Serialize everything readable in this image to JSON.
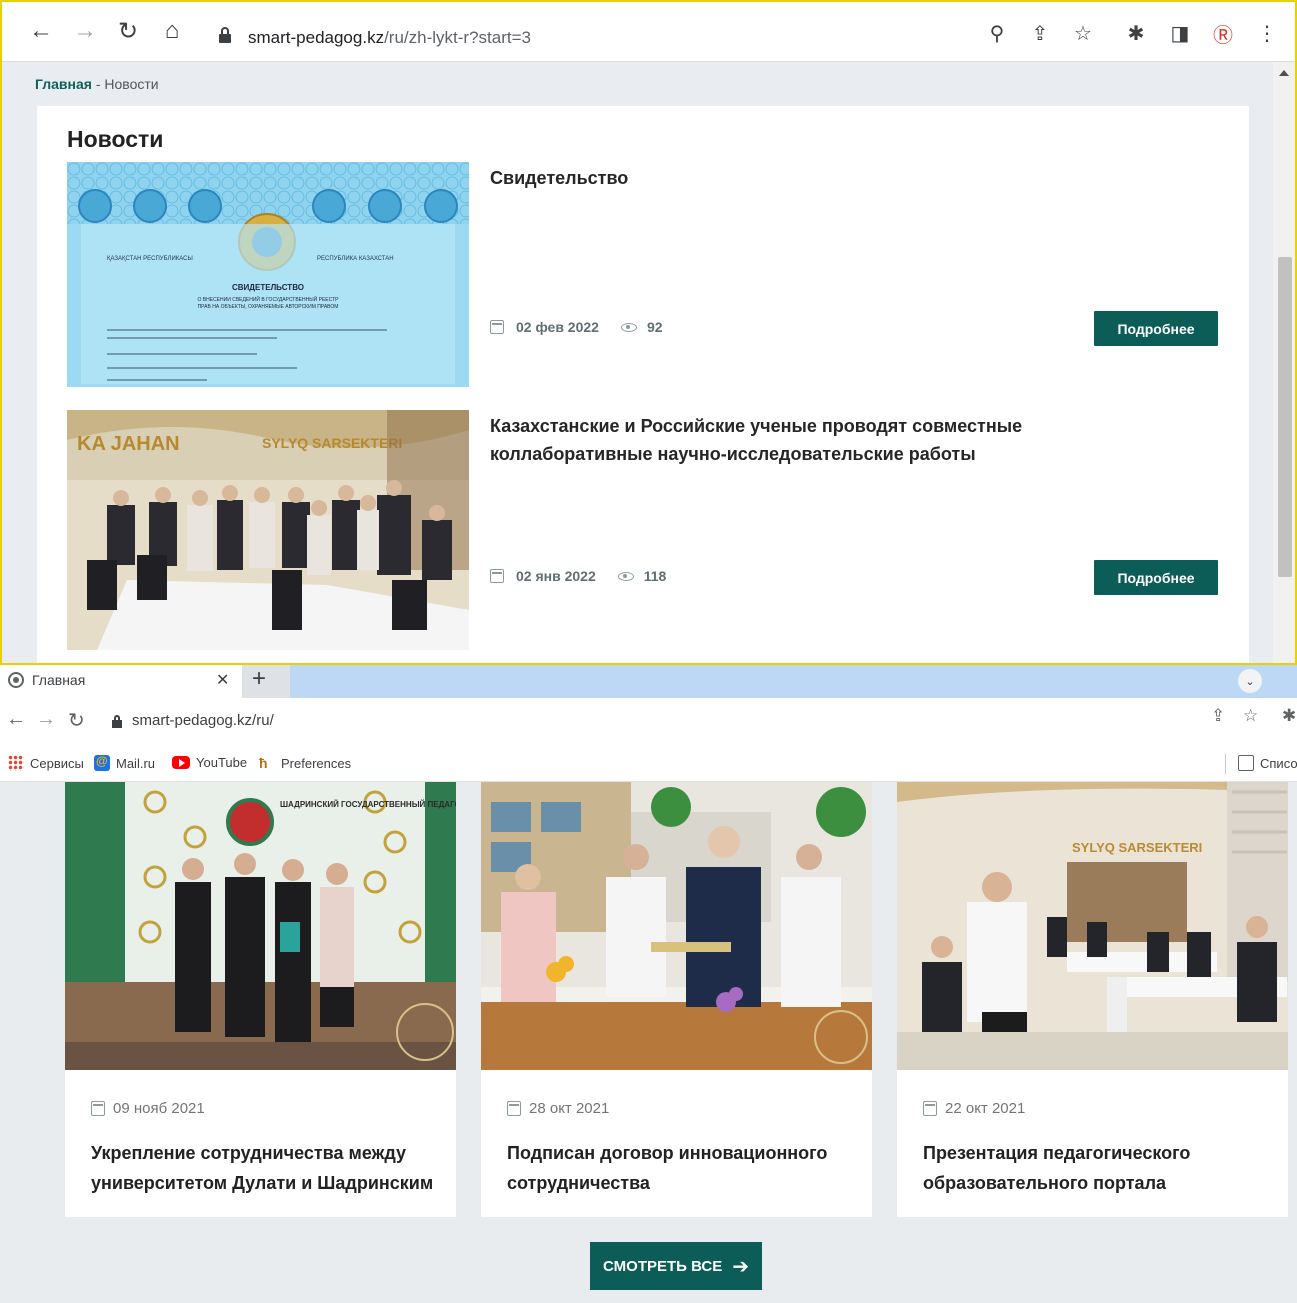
{
  "top_window": {
    "url_domain": "smart-pedagog.kz",
    "url_path": "/ru/zh-lykt-r?start=3",
    "breadcrumb": {
      "home": "Главная",
      "separator": " - ",
      "current": "Новости"
    },
    "section_title": "Новости",
    "news": [
      {
        "title": "Свидетельство",
        "date": "02 фев 2022",
        "views": "92",
        "button": "Подробнее"
      },
      {
        "title": "Казахстанские и Российские ученые проводят совместные коллаборативные научно-исследовательские работы",
        "date": "02 янв 2022",
        "views": "118",
        "button": "Подробнее"
      }
    ],
    "certificate": {
      "left_header": "ҚАЗАҚСТАН РЕСПУБЛИКАСЫ",
      "right_header": "РЕСПУБЛИКА КАЗАХСТАН",
      "heading": "СВИДЕТЕЛЬСТВО",
      "subheading_1": "О ВНЕСЕНИИ СВЕДЕНИЙ В ГОСУДАРСТВЕННЫЙ РЕЕСТР",
      "subheading_2": "ПРАВ НА ОБЪЕКТЫ, ОХРАНЯЕМЫЕ АВТОРСКИМ ПРАВОМ"
    },
    "photo_banner_left": "KA JAHAN",
    "photo_banner_right": "SYLYQ SARSEKTERI"
  },
  "bottom_window": {
    "tab_title": "Главная",
    "url": "smart-pedagog.kz/ru/",
    "bookmarks": [
      "Сервисы",
      "Mail.ru",
      "YouTube",
      "Preferences"
    ],
    "bookmarks_right": "Списо",
    "cards": [
      {
        "date": "09 нояб 2021",
        "title": "Укрепление сотрудничества между университетом Дулати и Шадринским"
      },
      {
        "date": "28 окт 2021",
        "title": "Подписан договор инновационного сотрудничества"
      },
      {
        "date": "22 окт 2021",
        "title": "Презентация педагогического образовательного портала www.smart-"
      }
    ],
    "poster_text": "ШАДРИНСКИЙ ГОСУДАРСТВЕННЫЙ ПЕДАГОГИЧЕСКИЙ УНИВЕРСИТЕТ",
    "photo_banner": "SYLYQ SARSEKTERI",
    "see_all": "СМОТРЕТЬ ВСЕ"
  },
  "colors": {
    "accent": "#0c5d57",
    "frame": "#e6d200",
    "background": "#e9edf1"
  }
}
